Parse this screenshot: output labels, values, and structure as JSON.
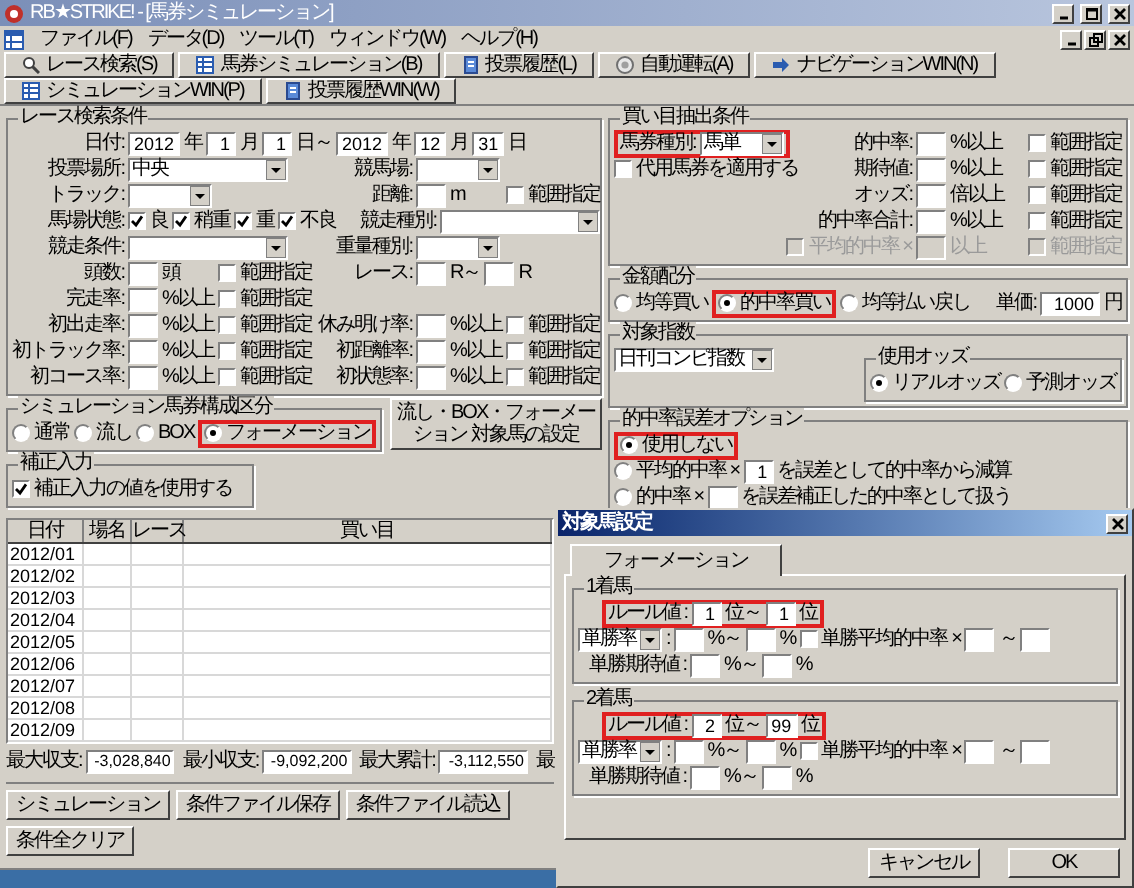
{
  "window": {
    "title": "RB★STRIKE! - [馬券シミュレーション]"
  },
  "menu": [
    "ファイル(F)",
    "データ(D)",
    "ツール(T)",
    "ウィンドウ(W)",
    "ヘルプ(H)"
  ],
  "toolbar": [
    "レース検索(S)",
    "馬券シミュレーション(B)",
    "投票履歴(L)",
    "自動運転(A)",
    "ナビゲーションWIN(N)",
    "シミュレーションWIN(P)",
    "投票履歴WIN(W)"
  ],
  "race_search": {
    "title": "レース検索条件",
    "rows": [
      {
        "items": [
          {
            "kind": "label",
            "text": "日付:"
          },
          {
            "kind": "field",
            "value": "2012"
          },
          {
            "kind": "unit",
            "text": "年"
          },
          {
            "kind": "field",
            "value": "1"
          },
          {
            "kind": "unit",
            "text": "月"
          },
          {
            "kind": "field",
            "value": "1"
          },
          {
            "kind": "unit",
            "text": "日～"
          },
          {
            "kind": "field",
            "value": "2012"
          },
          {
            "kind": "unit",
            "text": "年"
          },
          {
            "kind": "field",
            "value": "12"
          },
          {
            "kind": "unit",
            "text": "月"
          },
          {
            "kind": "field",
            "value": "31"
          },
          {
            "kind": "unit",
            "text": "日"
          }
        ]
      },
      {
        "left": [
          {
            "kind": "label",
            "text": "投票場所:"
          },
          {
            "kind": "combo_wide",
            "value": "中央"
          }
        ],
        "right": [
          {
            "kind": "label",
            "text": "競馬場:"
          },
          {
            "kind": "combo"
          }
        ]
      },
      {
        "left": [
          {
            "kind": "label",
            "text": "トラック:"
          },
          {
            "kind": "combo"
          }
        ],
        "right": [
          {
            "kind": "label",
            "text": "距離:"
          },
          {
            "kind": "field"
          },
          {
            "kind": "unit",
            "text": "m"
          },
          {
            "kind": "check",
            "label": "範囲指定",
            "checked": false
          }
        ]
      },
      {
        "left": [
          {
            "kind": "label",
            "text": "馬場状態:"
          },
          {
            "kind": "check",
            "label": "良",
            "checked": true
          },
          {
            "kind": "check",
            "label": "稍重",
            "checked": true
          },
          {
            "kind": "check",
            "label": "重",
            "checked": true
          },
          {
            "kind": "check",
            "label": "不良",
            "checked": true
          }
        ],
        "right": [
          {
            "kind": "label",
            "text": "競走種別:"
          },
          {
            "kind": "combo_wide"
          }
        ]
      },
      {
        "left": [
          {
            "kind": "label",
            "text": "競走条件:"
          },
          {
            "kind": "combo_wide"
          }
        ],
        "right": [
          {
            "kind": "label",
            "text": "重量種別:"
          },
          {
            "kind": "combo"
          }
        ]
      },
      {
        "left": [
          {
            "kind": "label",
            "text": "頭数:"
          },
          {
            "kind": "field"
          },
          {
            "kind": "unit",
            "text": "頭"
          },
          {
            "kind": "check",
            "label": "範囲指定",
            "checked": false
          }
        ],
        "right": [
          {
            "kind": "label",
            "text": "レース:"
          },
          {
            "kind": "field"
          },
          {
            "kind": "unit",
            "text": "R～"
          },
          {
            "kind": "field"
          },
          {
            "kind": "unit",
            "text": "R"
          }
        ]
      },
      {
        "left": [
          {
            "kind": "label",
            "text": "完走率:"
          },
          {
            "kind": "field"
          },
          {
            "kind": "unit",
            "text": "%以上"
          },
          {
            "kind": "check",
            "label": "範囲指定",
            "checked": false
          }
        ]
      },
      {
        "left": [
          {
            "kind": "label",
            "text": "初出走率:"
          },
          {
            "kind": "field"
          },
          {
            "kind": "unit",
            "text": "%以上"
          },
          {
            "kind": "check",
            "label": "範囲指定",
            "checked": false
          }
        ],
        "right": [
          {
            "kind": "label",
            "text": "休み明け率:"
          },
          {
            "kind": "field"
          },
          {
            "kind": "unit",
            "text": "%以上"
          },
          {
            "kind": "check",
            "label": "範囲指定",
            "checked": false
          }
        ]
      },
      {
        "left": [
          {
            "kind": "label",
            "text": "初トラック率:"
          },
          {
            "kind": "field"
          },
          {
            "kind": "unit",
            "text": "%以上"
          },
          {
            "kind": "check",
            "label": "範囲指定",
            "checked": false
          }
        ],
        "right": [
          {
            "kind": "label",
            "text": "初距離率:"
          },
          {
            "kind": "field"
          },
          {
            "kind": "unit",
            "text": "%以上"
          },
          {
            "kind": "check",
            "label": "範囲指定",
            "checked": false
          }
        ]
      },
      {
        "left": [
          {
            "kind": "label",
            "text": "初コース率:"
          },
          {
            "kind": "field"
          },
          {
            "kind": "unit",
            "text": "%以上"
          },
          {
            "kind": "check",
            "label": "範囲指定",
            "checked": false
          }
        ],
        "right": [
          {
            "kind": "label",
            "text": "初状態率:"
          },
          {
            "kind": "field"
          },
          {
            "kind": "unit",
            "text": "%以上"
          },
          {
            "kind": "check",
            "label": "範囲指定",
            "checked": false
          }
        ]
      }
    ]
  },
  "sim_mode": {
    "title": "シミュレーション馬券構成区分",
    "rows": [
      {
        "items": [
          {
            "kind": "radio",
            "label": "通常",
            "selected": false
          },
          {
            "kind": "radio",
            "label": "流し",
            "selected": false
          },
          {
            "kind": "radio",
            "label": "BOX",
            "selected": false
          },
          {
            "kind": "highlight",
            "items": [
              {
                "kind": "radio",
                "label": "フォーメーション",
                "selected": true
              }
            ]
          }
        ]
      }
    ]
  },
  "target_button": "流し・BOX・フォーメーション 対象馬の設定",
  "correction": {
    "title": "補正入力",
    "rows": [
      {
        "items": [
          {
            "kind": "check",
            "label": "補正入力の値を使用する",
            "checked": true
          }
        ]
      }
    ]
  },
  "table": {
    "columns": [
      "日付",
      "場名",
      "レース",
      "買い目"
    ],
    "rows": [
      {
        "date": "2012/01"
      },
      {
        "date": "2012/02"
      },
      {
        "date": "2012/03"
      },
      {
        "date": "2012/04"
      },
      {
        "date": "2012/05"
      },
      {
        "date": "2012/06"
      },
      {
        "date": "2012/07"
      },
      {
        "date": "2012/08"
      },
      {
        "date": "2012/09"
      }
    ]
  },
  "summary": [
    {
      "label": "最大収支:",
      "value": "-3,028,840"
    },
    {
      "label": "最小収支:",
      "value": "-9,092,200"
    },
    {
      "label": "最大累計:",
      "value": "-3,112,550"
    },
    {
      "label": "最"
    }
  ],
  "buttons": [
    "シミュレーション",
    "条件ファイル保存",
    "条件ファイル読込",
    "条件全クリア"
  ],
  "ticket_conditions": {
    "title": "買い目抽出条件",
    "rows": [
      {
        "disabled": false,
        "left": [
          {
            "kind": "highlight",
            "items": [
              {
                "kind": "label",
                "text": "馬券種別:"
              },
              {
                "kind": "combo",
                "value": "馬単"
              }
            ]
          }
        ],
        "right": [
          {
            "kind": "label",
            "text": "的中率:"
          },
          {
            "kind": "field"
          },
          {
            "kind": "unit",
            "text": "%以上"
          },
          {
            "kind": "check",
            "label": "範囲指定",
            "checked": false
          }
        ]
      },
      {
        "disabled": false,
        "left": [
          {
            "kind": "check",
            "label": "代用馬券を適用する",
            "checked": false
          }
        ],
        "right": [
          {
            "kind": "label",
            "text": "期待値:"
          },
          {
            "kind": "field"
          },
          {
            "kind": "unit",
            "text": "%以上"
          },
          {
            "kind": "check",
            "label": "範囲指定",
            "checked": false
          }
        ]
      },
      {
        "disabled": false,
        "right": [
          {
            "kind": "label",
            "text": "オッズ:"
          },
          {
            "kind": "field"
          },
          {
            "kind": "unit",
            "text": "倍以上"
          },
          {
            "kind": "check",
            "label": "範囲指定",
            "checked": false
          }
        ]
      },
      {
        "disabled": false,
        "right": [
          {
            "kind": "label",
            "text": "的中率合計:"
          },
          {
            "kind": "field"
          },
          {
            "kind": "unit",
            "text": "%以上"
          },
          {
            "kind": "check",
            "label": "範囲指定",
            "checked": false
          }
        ]
      },
      {
        "disabled": true,
        "right": [
          {
            "kind": "check",
            "label": "平均的中率 ×",
            "checked": false
          },
          {
            "kind": "field"
          },
          {
            "kind": "unit",
            "text": "以上"
          },
          {
            "kind": "check",
            "label": "範囲指定",
            "checked": false
          }
        ]
      }
    ]
  },
  "allocation": {
    "title": "金額配分",
    "rows": [
      {
        "left": [
          {
            "kind": "radio",
            "label": "均等買い",
            "selected": false
          },
          {
            "kind": "highlight",
            "items": [
              {
                "kind": "radio",
                "label": "的中率買い",
                "selected": true
              }
            ]
          },
          {
            "kind": "radio",
            "label": "均等払い戻し",
            "selected": false
          }
        ],
        "right": [
          {
            "kind": "label",
            "text": "単価:"
          },
          {
            "kind": "field_wide",
            "value": "1000"
          },
          {
            "kind": "unit",
            "text": "円"
          }
        ]
      }
    ]
  },
  "index_group": {
    "title": "対象指数",
    "rows": [
      {
        "items": [
          {
            "kind": "combo_wide",
            "value": "日刊コンピ指数"
          }
        ]
      }
    ],
    "groups": [
      {
        "title": "使用オッズ",
        "rows": [
          {
            "items": [
              {
                "kind": "radio",
                "label": "リアルオッズ",
                "selected": true
              },
              {
                "kind": "radio",
                "label": "予測オッズ",
                "selected": false
              }
            ]
          }
        ]
      }
    ]
  },
  "error_option": {
    "title": "的中率誤差オプション",
    "rows": [
      {
        "items": [
          {
            "kind": "highlight",
            "items": [
              {
                "kind": "radio",
                "label": "使用しない",
                "selected": true
              }
            ]
          }
        ]
      },
      {
        "items": [
          {
            "kind": "radio",
            "label": "平均的中率 ×",
            "selected": false
          },
          {
            "kind": "field",
            "value": "1"
          },
          {
            "kind": "unit",
            "text": "を誤差として的中率から減算"
          }
        ]
      },
      {
        "items": [
          {
            "kind": "radio",
            "label": "的中率 ×",
            "selected": false
          },
          {
            "kind": "field"
          },
          {
            "kind": "unit",
            "text": "を誤差補正した的中率として扱う"
          }
        ]
      }
    ]
  },
  "dialog": {
    "title": "対象馬設定",
    "tabs": [
      {
        "label": "フォーメーション",
        "selected": true
      }
    ],
    "groups": [
      {
        "title": "1着馬",
        "rows": [
          {
            "items": [
              {
                "kind": "highlight",
                "items": [
                  {
                    "kind": "label",
                    "text": "ルール値 :"
                  },
                  {
                    "kind": "field",
                    "value": "1"
                  },
                  {
                    "kind": "unit",
                    "text": "位～"
                  },
                  {
                    "kind": "field",
                    "value": "1"
                  },
                  {
                    "kind": "unit",
                    "text": "位"
                  }
                ]
              }
            ]
          },
          {
            "items": [
              {
                "kind": "combo",
                "value": "単勝率"
              },
              {
                "kind": "unit",
                "text": ":"
              },
              {
                "kind": "field"
              },
              {
                "kind": "unit",
                "text": "%～"
              },
              {
                "kind": "field"
              },
              {
                "kind": "unit",
                "text": "%"
              },
              {
                "kind": "check",
                "label": "単勝平均的中率",
                "checked": false
              },
              {
                "kind": "unit",
                "text": "×"
              },
              {
                "kind": "field"
              },
              {
                "kind": "unit",
                "text": "～"
              },
              {
                "kind": "field"
              }
            ]
          },
          {
            "items": [
              {
                "kind": "label",
                "text": "単勝期待値 :"
              },
              {
                "kind": "field"
              },
              {
                "kind": "unit",
                "text": "%～"
              },
              {
                "kind": "field"
              },
              {
                "kind": "unit",
                "text": "%"
              }
            ]
          }
        ]
      },
      {
        "title": "2着馬",
        "rows": [
          {
            "items": [
              {
                "kind": "highlight",
                "items": [
                  {
                    "kind": "label",
                    "text": "ルール値 :"
                  },
                  {
                    "kind": "field",
                    "value": "2"
                  },
                  {
                    "kind": "unit",
                    "text": "位～"
                  },
                  {
                    "kind": "field",
                    "value": "99"
                  },
                  {
                    "kind": "unit",
                    "text": "位"
                  }
                ]
              }
            ]
          },
          {
            "items": [
              {
                "kind": "combo",
                "value": "単勝率"
              },
              {
                "kind": "unit",
                "text": ":"
              },
              {
                "kind": "field"
              },
              {
                "kind": "unit",
                "text": "%～"
              },
              {
                "kind": "field"
              },
              {
                "kind": "unit",
                "text": "%"
              },
              {
                "kind": "check",
                "label": "単勝平均的中率",
                "checked": false
              },
              {
                "kind": "unit",
                "text": "×"
              },
              {
                "kind": "field"
              },
              {
                "kind": "unit",
                "text": "～"
              },
              {
                "kind": "field"
              }
            ]
          },
          {
            "items": [
              {
                "kind": "label",
                "text": "単勝期待値 :"
              },
              {
                "kind": "field"
              },
              {
                "kind": "unit",
                "text": "%～"
              },
              {
                "kind": "field"
              },
              {
                "kind": "unit",
                "text": "%"
              }
            ]
          }
        ]
      }
    ],
    "buttons": [
      "キャンセル",
      "OK"
    ]
  }
}
